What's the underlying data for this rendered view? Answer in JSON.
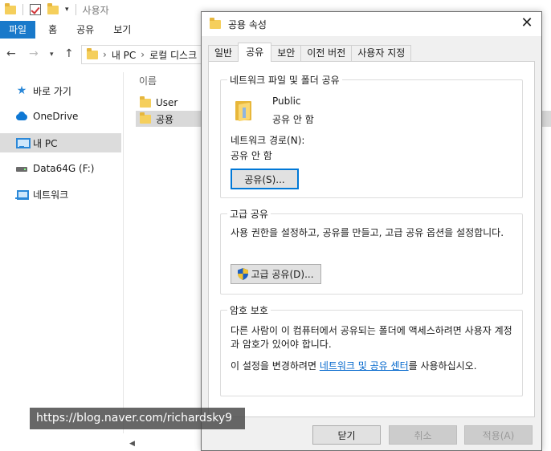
{
  "explorer": {
    "title": "사용자",
    "ribbon_tabs": [
      "파일",
      "홈",
      "공유",
      "보기"
    ],
    "breadcrumb": [
      "내 PC",
      "로컬 디스크"
    ],
    "nav_items": [
      {
        "label": "바로 가기",
        "icon": "star-icon"
      },
      {
        "label": "OneDrive",
        "icon": "cloud-icon"
      },
      {
        "label": "내 PC",
        "icon": "computer-icon"
      },
      {
        "label": "Data64G (F:)",
        "icon": "drive-icon"
      },
      {
        "label": "네트워크",
        "icon": "network-icon"
      }
    ],
    "column_header": "이름",
    "files": [
      {
        "name": "User"
      },
      {
        "name": "공용"
      }
    ]
  },
  "dialog": {
    "title": "공용 속성",
    "close_glyph": "✕",
    "tabs": [
      "일반",
      "공유",
      "보안",
      "이전 버전",
      "사용자 지정"
    ],
    "active_tab": "공유",
    "network_sharing": {
      "legend": "네트워크 파일 및 폴더 공유",
      "folder_name": "Public",
      "folder_status": "공유 안 함",
      "path_label": "네트워크 경로(N):",
      "path_value": "공유 안 함",
      "share_button": "공유(S)..."
    },
    "advanced_sharing": {
      "legend": "고급 공유",
      "description": "사용 권한을 설정하고, 공유를 만들고, 고급 공유 옵션을 설정합니다.",
      "button": "고급 공유(D)..."
    },
    "password_protection": {
      "legend": "암호 보호",
      "description": "다른 사람이 이 컴퓨터에서 공유되는 폴더에 액세스하려면 사용자 계정과 암호가 있어야 합니다.",
      "change_prefix": "이 설정을 변경하려면 ",
      "change_link": "네트워크 및 공유 센터",
      "change_suffix": "를 사용하십시오."
    },
    "buttons": {
      "close": "닫기",
      "cancel": "취소",
      "apply": "적용(A)"
    }
  },
  "watermark": "https://blog.naver.com/richardsky9",
  "colors": {
    "accent": "#1979ca",
    "link": "#0066cc",
    "focus": "#0078d7"
  }
}
